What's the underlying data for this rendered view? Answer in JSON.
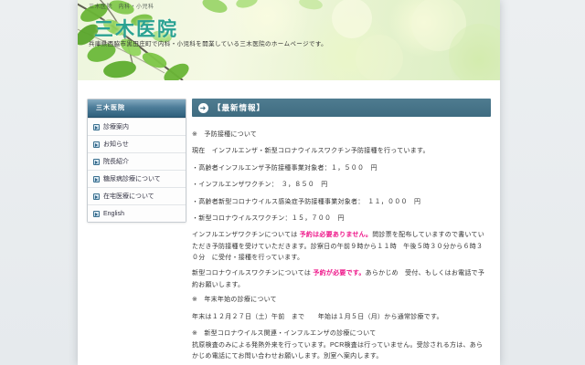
{
  "colors": {
    "outer_bg": "#e9edf0",
    "title_teal": "#2aa292",
    "sidebar_header_blue": "#4d7d99",
    "main_header_blue": "#3e6b80",
    "emphasis_pink": "#ee1488",
    "body_text": "#333333"
  },
  "header": {
    "top_text": "三木医院　内科・小児科",
    "title": "三木医院",
    "subtitle": "兵庫県西脇市黒田庄町で内科・小児科を開業している三木医院のホームページです。"
  },
  "sidebar": {
    "title": "三木医院",
    "items": [
      {
        "label": "診療案内"
      },
      {
        "label": "お知らせ"
      },
      {
        "label": "院長紹介"
      },
      {
        "label": "糖尿病診療について"
      },
      {
        "label": "在宅医療について"
      },
      {
        "label": "English"
      }
    ]
  },
  "main": {
    "header_label": "【最新情報】",
    "arrow_icon": "➜",
    "lines": {
      "l1": "※　予防接種について",
      "l2": "現在　インフルエンザ・新型コロナウイルスワクチン予防接種を行っています。",
      "l3": "・高齢者インフルエンザ予防接種事業対象者：１，５００　円",
      "l4": "・インフルエンザワクチン：　３，８５０　円",
      "l5": "・高齢者新型コロナウイルス感染症予防接種事業対象者：　１１，０００　円",
      "l6": "・新型コロナウイルスワクチン：１５，７００　円",
      "p1a": "インフルエンザワクチンについては ",
      "p1b": "予約は必要ありません。",
      "p1c": "問診票を配布していますので書いていただき予防接種を受けていただきます。診察日の午前９時から１１時　午後５時３０分から６時３０分　に受付・接種を行っています。",
      "p2a": "新型コロナウイルスワクチンについては ",
      "p2b": "予約が必要です。",
      "p2c": "あらかじめ　受付、もしくはお電話で予約お願いします。",
      "l7": "※　年末年始の診療について",
      "l8": "年末は１２月２７日（土）午前　まで　　年始は１月５日（月）から通常診療です。",
      "l9": "※　新型コロナウイルス関連・インフルエンザの診療について",
      "l10": "抗原検査のみによる発熱外来を行っています。PCR検査は行っていません。受診される方は、あらかじめ電話にてお問い合わせお願いします。別室へ案内します。"
    }
  }
}
